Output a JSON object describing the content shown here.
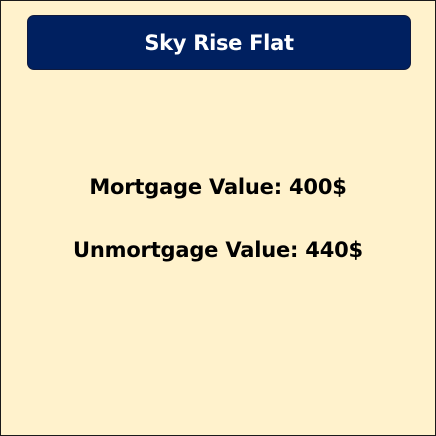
{
  "card": {
    "title": "Sky Rise Flat",
    "mortgage_text": "Mortgage Value: 400$",
    "unmortgage_text": "Unmortgage Value: 440$"
  },
  "colors": {
    "card_background": "#fff2cc",
    "title_background": "#002060",
    "title_text": "#ffffff",
    "body_text": "#000000"
  }
}
